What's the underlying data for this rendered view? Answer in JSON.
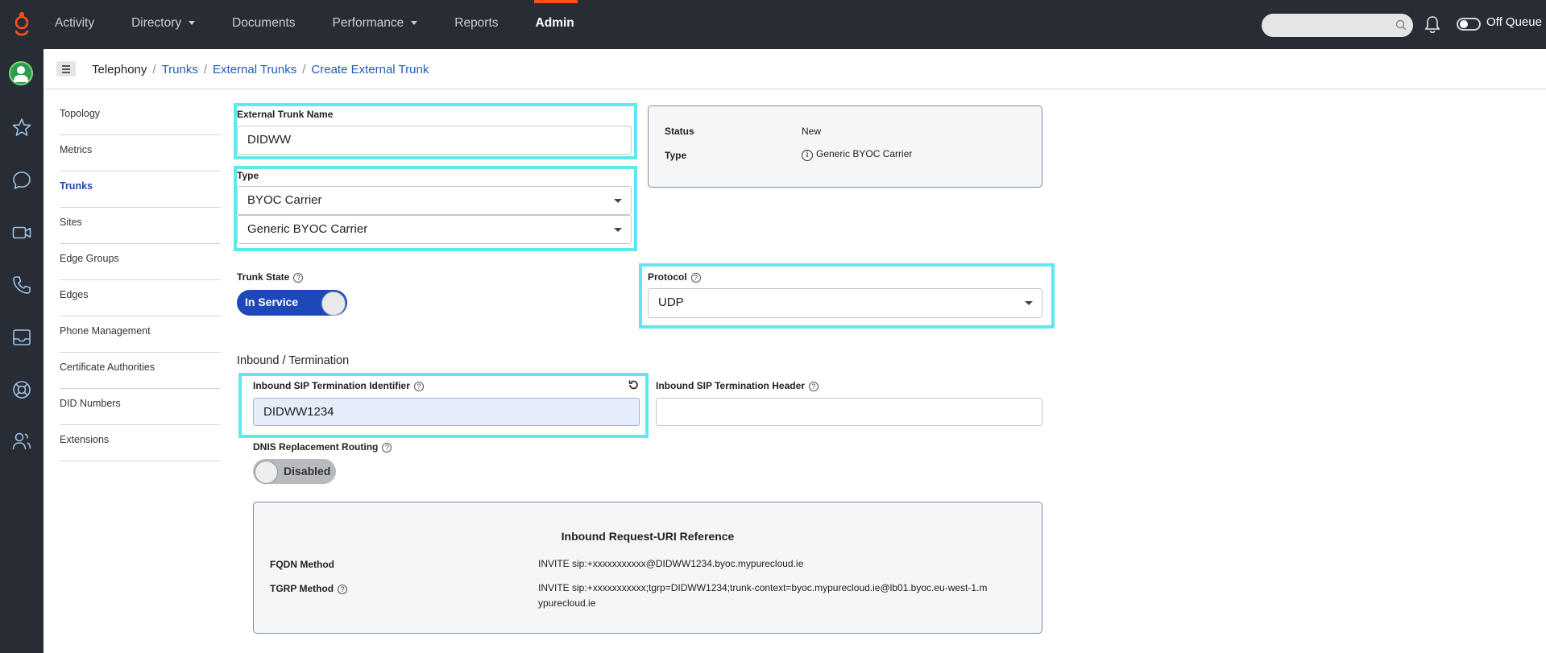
{
  "topbar": {
    "nav": [
      {
        "label": "Activity",
        "caret": false,
        "active": false
      },
      {
        "label": "Directory",
        "caret": true,
        "active": false
      },
      {
        "label": "Documents",
        "caret": false,
        "active": false
      },
      {
        "label": "Performance",
        "caret": true,
        "active": false
      },
      {
        "label": "Reports",
        "caret": false,
        "active": false
      },
      {
        "label": "Admin",
        "caret": false,
        "active": true
      }
    ],
    "search_placeholder": "",
    "queue_label": "Off Queue"
  },
  "rail": {
    "icons": [
      "star-icon",
      "chat-bubble-icon",
      "video-icon",
      "phone-icon",
      "inbox-icon",
      "lifebuoy-icon",
      "people-icon"
    ]
  },
  "breadcrumb": [
    "Telephony",
    "Trunks",
    "External Trunks",
    "Create External Trunk"
  ],
  "sidenav": {
    "items": [
      "Topology",
      "Metrics",
      "Trunks",
      "Sites",
      "Edge Groups",
      "Edges",
      "Phone Management",
      "Certificate Authorities",
      "DID Numbers",
      "Extensions"
    ],
    "active": "Trunks"
  },
  "form": {
    "trunk_name_label": "External Trunk Name",
    "trunk_name_value": "DIDWW",
    "type_label": "Type",
    "type_value": "BYOC Carrier",
    "subtype_value": "Generic BYOC Carrier",
    "trunk_state_label": "Trunk State",
    "trunk_state_value": "In Service",
    "protocol_label": "Protocol",
    "protocol_value": "UDP",
    "inbound_section": "Inbound / Termination",
    "sip_id_label": "Inbound SIP Termination Identifier",
    "sip_id_value": "DIDWW1234",
    "sip_header_label": "Inbound SIP Termination Header",
    "sip_header_value": "",
    "dnis_label": "DNIS Replacement Routing",
    "dnis_value": "Disabled"
  },
  "status_box": {
    "status_key": "Status",
    "status_value": "New",
    "type_key": "Type",
    "type_value": "Generic BYOC Carrier"
  },
  "reference": {
    "title": "Inbound Request-URI Reference",
    "fqdn_key": "FQDN Method",
    "fqdn_value": "INVITE sip:+xxxxxxxxxxx@DIDWW1234.byoc.mypurecloud.ie",
    "tgrp_key": "TGRP Method",
    "tgrp_value": "INVITE sip:+xxxxxxxxxxx;tgrp=DIDWW1234;trunk-context=byoc.mypurecloud.ie@lb01.byoc.eu-west-1.mypurecloud.ie"
  },
  "colors": {
    "topbar": "#282c34",
    "accent": "#ff4f1f",
    "link": "#1e5bb8",
    "highlight": "#5ee8ef",
    "toggle_on": "#1e48b8"
  }
}
